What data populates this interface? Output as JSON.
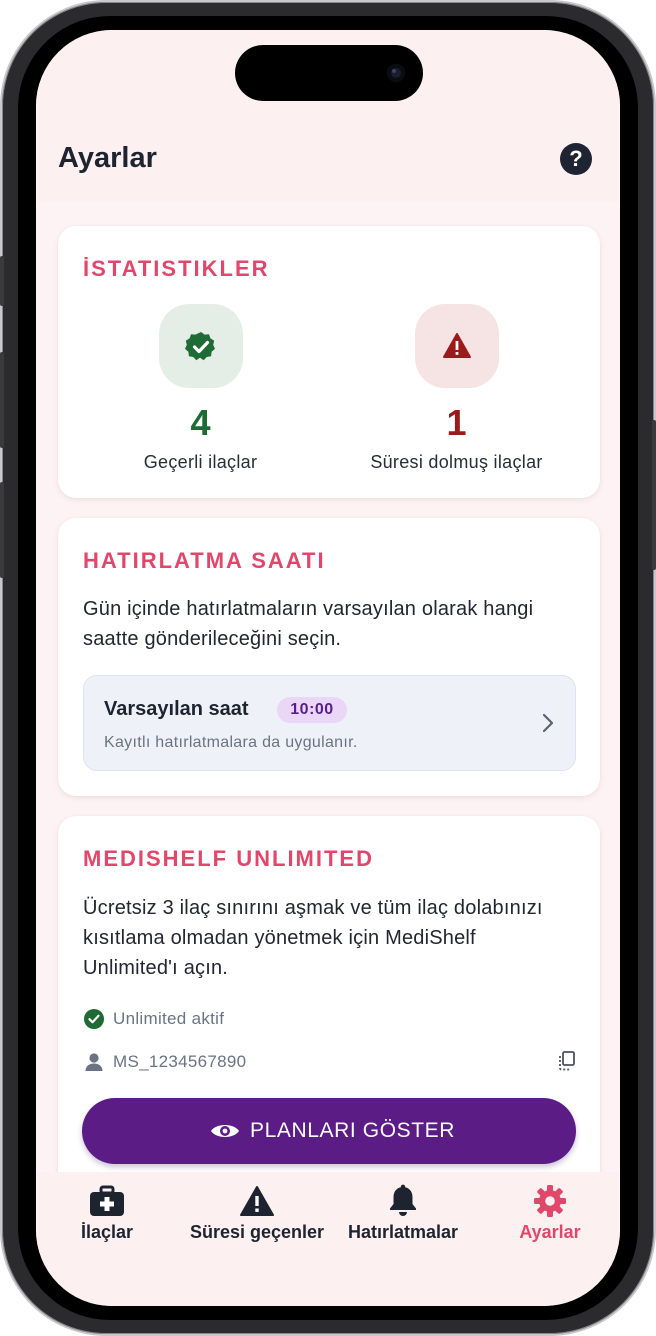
{
  "header": {
    "title": "Ayarlar",
    "help_icon": "question-mark-circle-icon",
    "help_glyph": "?"
  },
  "stats": {
    "title": "İSTATISTIKLER",
    "valid": {
      "count": "4",
      "label": "Geçerli ilaçlar",
      "icon": "verified-badge-icon",
      "color": "#1e6b35"
    },
    "expired": {
      "count": "1",
      "label": "Süresi dolmuş ilaçlar",
      "icon": "warning-triangle-icon",
      "color": "#9c1a1a"
    }
  },
  "reminder": {
    "title": "HATIRLATMA SAATI",
    "description": "Gün içinde hatırlatmaların varsayılan olarak hangi saatte gönderileceğini seçin.",
    "default_time_label": "Varsayılan saat",
    "default_time_value": "10:00",
    "default_time_hint": "Kayıtlı hatırlatmalara da uygulanır."
  },
  "unlimited": {
    "title": "MEDISHELF UNLIMITED",
    "description": "Ücretsiz 3 ilaç sınırını aşmak ve tüm ilaç dolabınızı kısıtlama olmadan yönetmek için MediShelf Unlimited'ı açın.",
    "status_text": "Unlimited aktif",
    "user_id": "MS_1234567890",
    "button_label": "PLANLARI GÖSTER"
  },
  "nav": {
    "items": [
      {
        "label": "İlaçlar",
        "icon": "medical-kit-icon",
        "active": false
      },
      {
        "label": "Süresi geçenler",
        "icon": "warning-triangle-icon",
        "active": false
      },
      {
        "label": "Hatırlatmalar",
        "icon": "bell-icon",
        "active": false
      },
      {
        "label": "Ayarlar",
        "icon": "gear-icon",
        "active": true
      }
    ]
  },
  "colors": {
    "accent": "#e0476a",
    "primary": "#5b1c86",
    "background": "#fdf3f4"
  }
}
